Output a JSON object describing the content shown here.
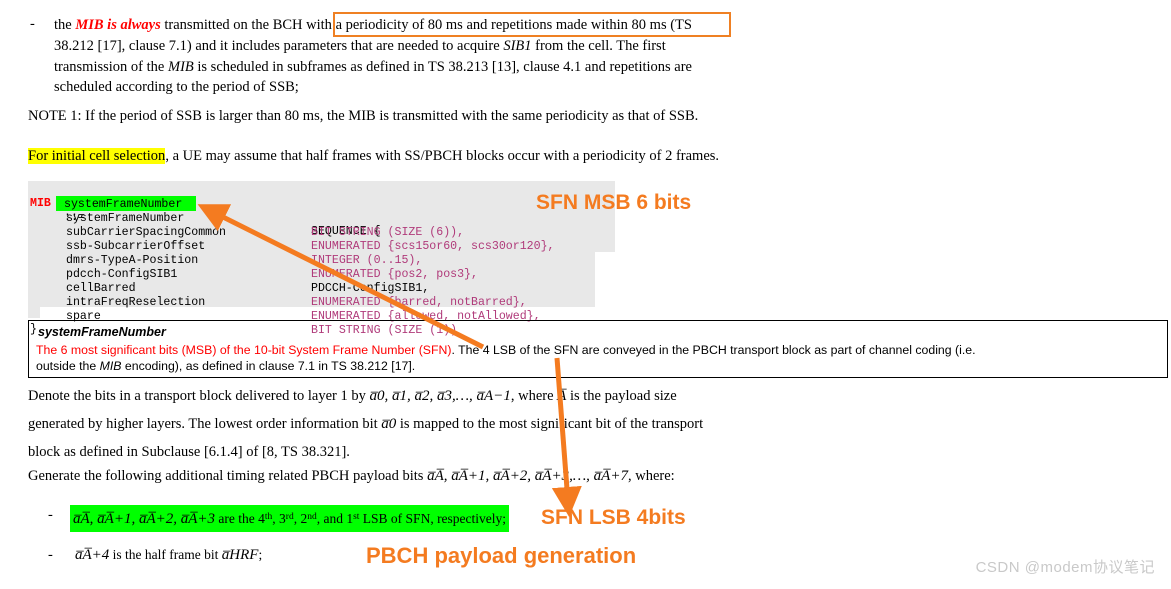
{
  "document": {
    "bullet_marker": "-",
    "para1": {
      "lead": "the ",
      "emphasis": "MIB is always",
      "mid": " transmitted on the BCH with ",
      "boxed": "a periodicity of 80 ms and repetitions made within 80 ms",
      "rest_line1": " (TS",
      "line2": "38.212 [17], clause 7.1) and it includes parameters that are needed to acquire ",
      "line2_italic": "SIB1",
      "line2_tail": " from the cell. The first",
      "line3_a": "transmission of the ",
      "line3_italic": "MIB",
      "line3_b": " is scheduled in subframes as defined in TS 38.213 [13], clause 4.1 and repetitions are",
      "line4": "scheduled according to the period of SSB;"
    },
    "note1": "NOTE 1:  If the period of SSB is larger than 80 ms, the MIB is transmitted with the same periodicity as that of SSB.",
    "initial_cell_selection": {
      "highlighted": "For initial cell selection",
      "rest": ", a UE may assume that half frames with SS/PBCH blocks occur with a periodicity of 2 frames."
    },
    "denote_para": {
      "line1_a": "Denote the bits in a transport block delivered to layer 1 by ",
      "line1_math": "a̅0, a̅1, a̅2, a̅3,…, a̅A−1",
      "line1_b": ", where ",
      "line1_math2": "A̅",
      "line1_c": " is the payload size",
      "line2_a": "generated by higher layers. The lowest order information bit ",
      "line2_math": "a̅0",
      "line2_b": " is mapped to the most significant bit of the transport",
      "line3": "block as defined in Subclause [6.1.4] of [8, TS 38.321]."
    },
    "generate_para": {
      "lead": "Generate the following additional timing related PBCH payload bits ",
      "math": "a̅A̅, a̅A̅+1, a̅A̅+2, a̅A̅+3,…, a̅A̅+7",
      "tail": ", where:"
    },
    "bullet_lsb": {
      "math": "a̅A̅, a̅A̅+1, a̅A̅+2, a̅A̅+3",
      "text_a": " are the 4",
      "sup1": "th",
      "text_b": ", 3",
      "sup2": "rd",
      "text_c": ", 2",
      "sup3": "nd",
      "text_d": ", and 1",
      "sup4": "st",
      "text_e": " LSB of SFN, respectively;"
    },
    "bullet_hrf": {
      "math": "a̅A̅+4",
      "text": " is the half frame bit ",
      "math2": "a̅HRF",
      "tail": ";"
    }
  },
  "code_block": {
    "language": "ASN.1",
    "header_name": "MIB",
    "header_assign": "::=",
    "header_type": "SEQUENCE {",
    "closing_brace": "}",
    "rows": [
      {
        "name": "systemFrameNumber",
        "type": "BIT STRING (SIZE (6)),",
        "type_color": "purple",
        "highlight": "green"
      },
      {
        "name": "subCarrierSpacingCommon",
        "type": "ENUMERATED {scs15or60, scs30or120},",
        "type_color": "purple",
        "highlight": "none"
      },
      {
        "name": "ssb-SubcarrierOffset",
        "type": "INTEGER (0..15),",
        "type_color": "purple",
        "highlight": "none"
      },
      {
        "name": "dmrs-TypeA-Position",
        "type": "ENUMERATED {pos2, pos3},",
        "type_color": "purple",
        "highlight": "none"
      },
      {
        "name": "pdcch-ConfigSIB1",
        "type": "PDCCH-ConfigSIB1,",
        "type_color": "black",
        "highlight": "none"
      },
      {
        "name": "cellBarred",
        "type": "ENUMERATED {barred, notBarred},",
        "type_color": "purple",
        "highlight": "none"
      },
      {
        "name": "intraFreqReselection",
        "type": "ENUMERATED {allowed, notAllowed},",
        "type_color": "purple",
        "highlight": "none"
      },
      {
        "name": "spare",
        "type": "BIT STRING (SIZE (1))",
        "type_color": "purple",
        "highlight": "none"
      }
    ]
  },
  "description_box": {
    "title": "systemFrameNumber",
    "line1_red": "The 6 most significant bits (MSB) of the 10-bit System Frame Number (SFN)",
    "line1_black": ". The 4 LSB of the SFN are conveyed in the PBCH transport block as part of channel coding (i.e.",
    "line2_a": "outside the ",
    "line2_italic": "MIB",
    "line2_b": " encoding), as defined in clause 7.1 in TS 38.212 [17]."
  },
  "annotations": [
    {
      "id": "sfn-msb",
      "label": "SFN MSB 6 bits"
    },
    {
      "id": "sfn-lsb",
      "label": "SFN LSB 4bits"
    },
    {
      "id": "pbch-gen",
      "label": "PBCH payload generation"
    }
  ],
  "watermark": "CSDN @modem协议笔记",
  "colors": {
    "annotation_orange": "#f47b20",
    "box_orange": "#ef8023",
    "highlight_green": "#00ff00",
    "highlight_yellow": "#ffff00",
    "code_background": "#e8e8e8",
    "code_type_purple": "#b03a7a",
    "emphasis_red": "#ff0000",
    "watermark_gray": "#c9c9c9"
  }
}
